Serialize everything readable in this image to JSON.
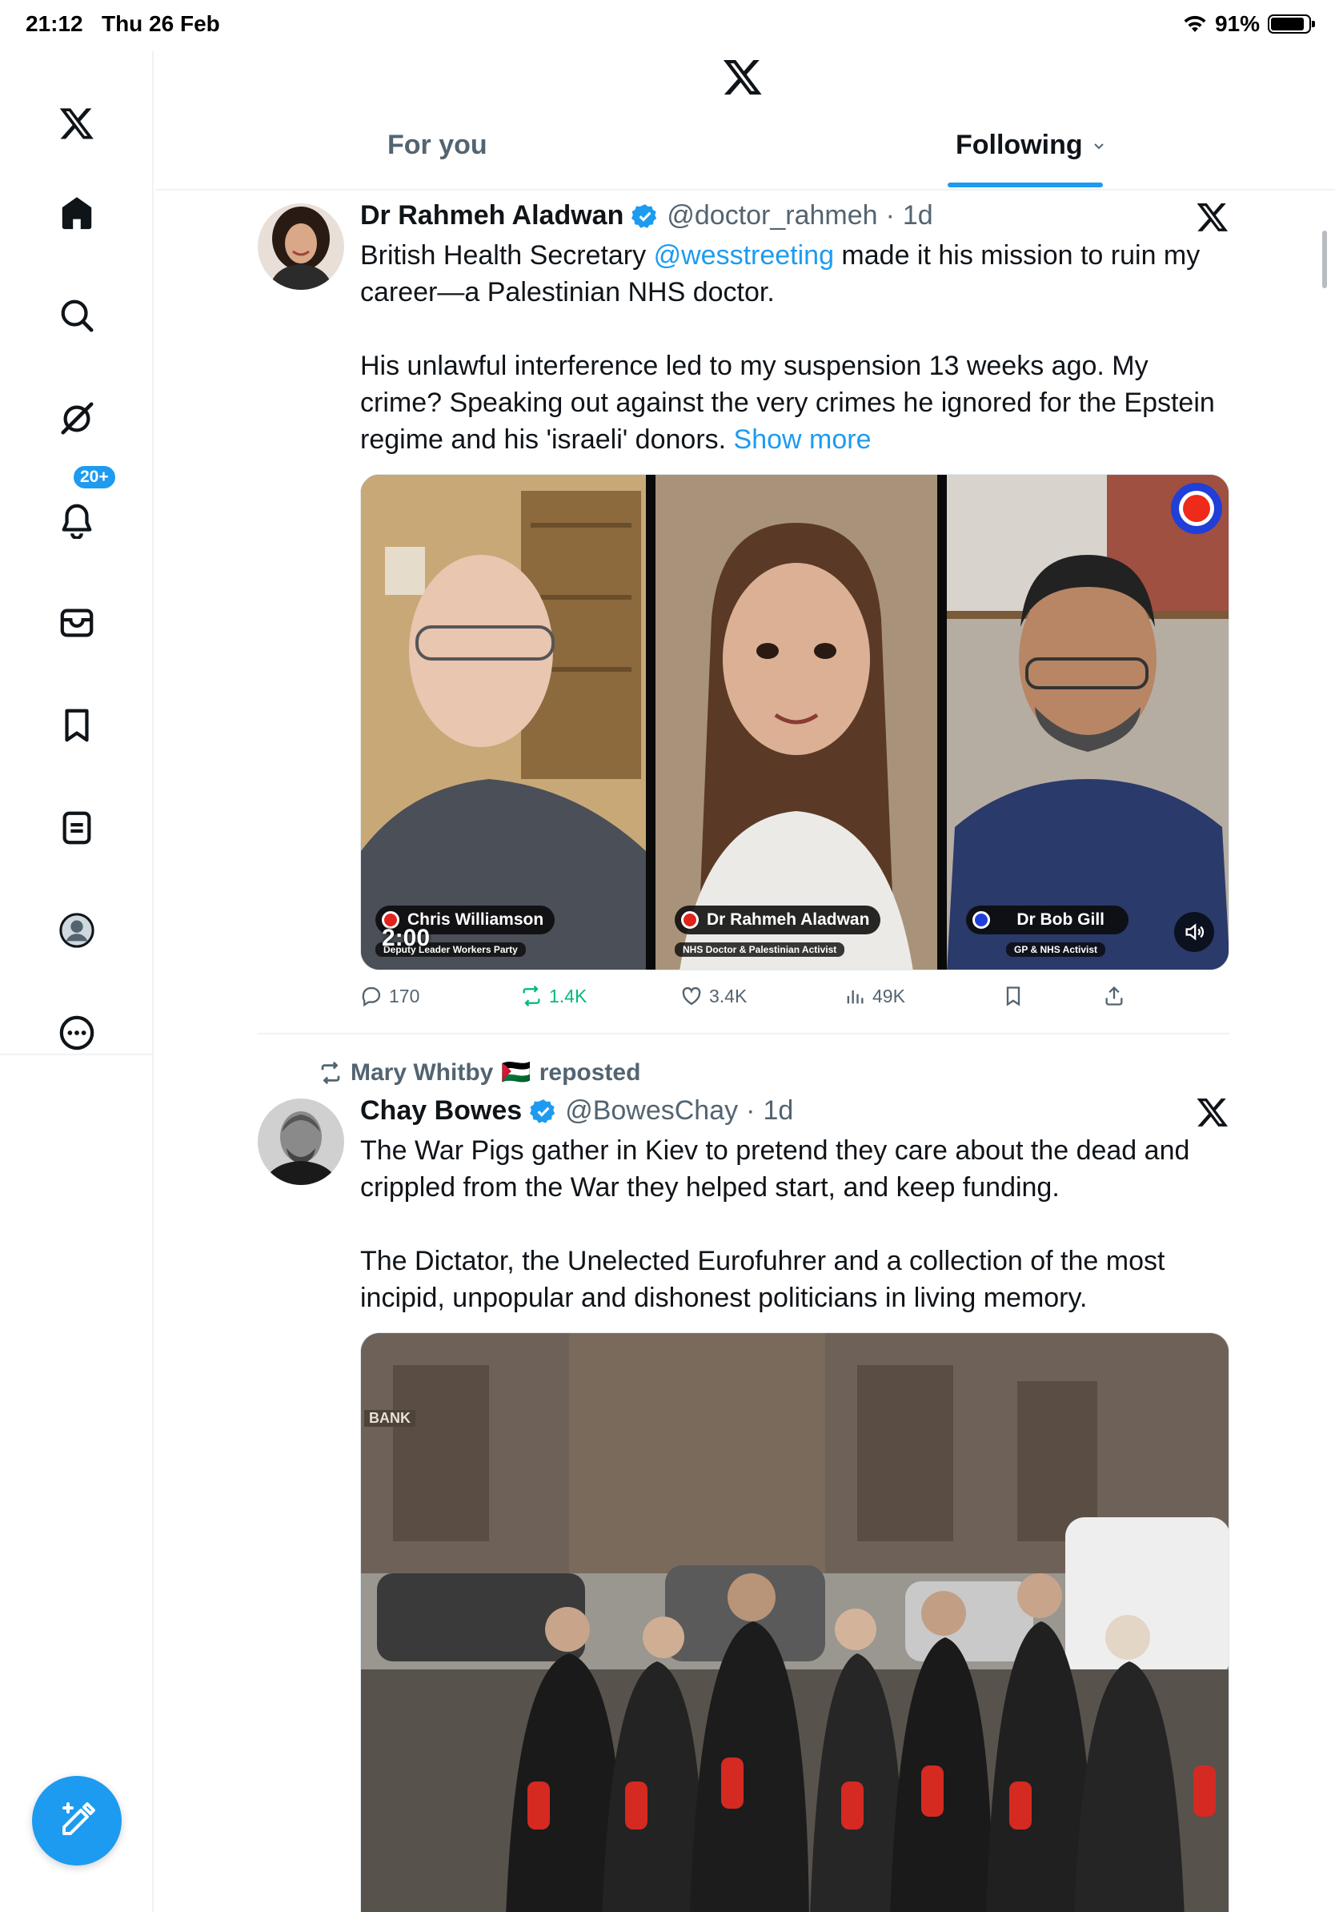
{
  "status_bar": {
    "time": "21:12",
    "date": "Thu 26 Feb",
    "battery": "91%"
  },
  "sidebar": {
    "items": [
      "x-logo",
      "home",
      "search",
      "grok",
      "notifications",
      "messages",
      "bookmarks",
      "lists",
      "profile",
      "more"
    ],
    "notification_badge": "20+"
  },
  "header": {
    "tab_for_you": "For you",
    "tab_following": "Following"
  },
  "post1": {
    "name": "Dr Rahmeh Aladwan",
    "handle": "@doctor_rahmeh",
    "dot": "·",
    "age": "1d",
    "text_1": "British Health Secretary ",
    "mention": "@wesstreeting",
    "text_2": " made it his mission to ruin my career—a Palestinian NHS doctor.",
    "text_3": "His unlawful interference led to my suspension 13 weeks ago. My crime? Speaking out against the very crimes he ignored for the Epstein regime and his 'israeli' donors. ",
    "show_more": "Show more",
    "video": {
      "duration": "2:00",
      "panel1_name": "Chris Williamson",
      "panel1_sub": "Deputy Leader Workers Party",
      "panel2_name": "Dr Rahmeh Aladwan",
      "panel2_sub": "NHS Doctor & Palestinian Activist",
      "panel3_name": "Dr Bob Gill",
      "panel3_sub": "GP & NHS Activist"
    },
    "stats": {
      "replies": "170",
      "reposts": "1.4K",
      "likes": "3.4K",
      "views": "49K"
    }
  },
  "post2": {
    "repost_by": "Mary Whitby",
    "repost_flag": "🇵🇸",
    "repost_label": "reposted",
    "name": "Chay Bowes",
    "handle": "@BowesChay",
    "dot": "·",
    "age": "1d",
    "text_1": "The War Pigs gather in Kiev to pretend they care about the dead and crippled from the War they helped start, and keep funding.",
    "text_2": "The Dictator, the Unelected Eurofuhrer and a collection of the most incipid, unpopular and dishonest politicians in living memory.",
    "image_sign": "BANK"
  },
  "colors": {
    "accent": "#1d9bf0",
    "text": "#0f1419",
    "secondary": "#536471",
    "repost_green": "#00ba7c"
  }
}
